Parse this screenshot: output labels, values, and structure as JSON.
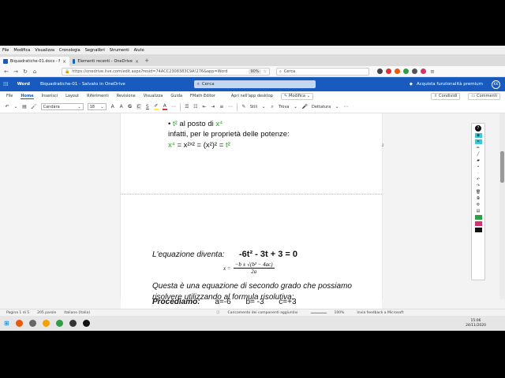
{
  "menubar": {
    "items": [
      "File",
      "Modifica",
      "Visualizza",
      "Cronologia",
      "Segnalibri",
      "Strumenti",
      "Aiuto"
    ]
  },
  "tabs": [
    {
      "title": "Biquadratiche-01.docx - Micro",
      "active": true
    },
    {
      "title": "Elementi recenti - OneDrive",
      "active": false
    }
  ],
  "navbar": {
    "url": "https://onedrive.live.com/edit.aspx?resid=74ACC2308383C9A!276&app=Word",
    "zoom": "90%",
    "search_placeholder": "Cerca"
  },
  "word_header": {
    "app_name": "Word",
    "doc_title": "Biquadratiche-01 - Salvato in OneDrive",
    "search_placeholder": "Cerca",
    "premium_label": "Acquista funzionalità premium",
    "avatar_initials": "KK"
  },
  "ribbon": {
    "tabs": [
      "File",
      "Home",
      "Inserisci",
      "Layout",
      "Riferimenti",
      "Revisione",
      "Visualizza",
      "Guida",
      "FMath Editor",
      "Apri nell'app desktop"
    ],
    "active_tab": "Home",
    "modify_label": "Modifica",
    "share_label": "Condividi",
    "comments_label": "Commenti"
  },
  "toolbar": {
    "font_name": "Candara",
    "font_size": "18",
    "styles_label": "Stili",
    "find_label": "Trova",
    "dictation_label": "Dettatura",
    "bold": "G",
    "italic": "C",
    "underline": "S"
  },
  "document": {
    "bullet_t2": "t²",
    "bullet_mid": "al posto di",
    "bullet_x4": "x⁴",
    "line2": "infatti, per le proprietà delle potenze:",
    "line3_a": "x⁴",
    "line3_b": "= x²ˣ² = (x²)² =",
    "line3_c": "t²",
    "page_num": "2",
    "equation_label": "L'equazione diventa:",
    "equation": "-6t² -  3t  +  3  = 0",
    "p2_line1": "Questa è una equazione di secondo grado che possiamo",
    "p2_line2": "risolvere utilizzando al formula risolutiva:",
    "formula_lhs": "x =",
    "formula_num": "−b ± √(b² − 4ac)",
    "formula_den": "2a",
    "proceed_label": "Procediamo:",
    "a_val": "a=-6",
    "b_val": "b= -3",
    "c_val": "c=+3"
  },
  "statusbar": {
    "page": "Pagina 1 di 5",
    "words": "205 parole",
    "language": "Italiano (Italia)",
    "loading": "Caricamento dei componenti aggiuntivi",
    "zoom": "100%",
    "feedback": "Invia feedback a Microsoft"
  },
  "taskbar": {
    "time": "15:06",
    "date": "24/11/2020"
  },
  "colors": {
    "word_blue": "#185abd",
    "green_text": "#2ca02c"
  }
}
